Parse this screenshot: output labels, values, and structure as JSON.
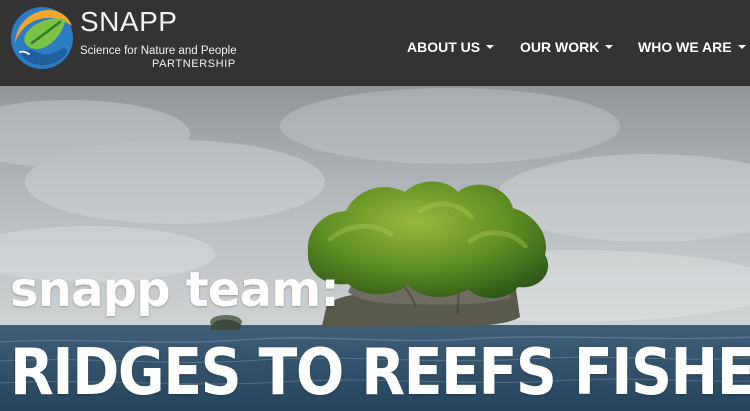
{
  "brand": {
    "wordmark": "SNAPP",
    "tagline": "Science for Nature and People",
    "partnership": "PARTNERSHIP"
  },
  "nav": {
    "items": [
      {
        "label": "ABOUT US"
      },
      {
        "label": "OUR WORK"
      },
      {
        "label": "WHO WE ARE"
      }
    ]
  },
  "hero": {
    "title": "snapp team:",
    "subtitle": "RIDGES TO REEFS FISHERIES"
  },
  "colors": {
    "header_bg": "#333333",
    "logo_orange": "#f4a62a",
    "logo_blue": "#2d7dc4",
    "logo_green": "#7cc243",
    "text_white": "#ffffff"
  },
  "icons": {
    "logo": "leaf-hand-logo-icon",
    "caret": "chevron-down-icon"
  }
}
